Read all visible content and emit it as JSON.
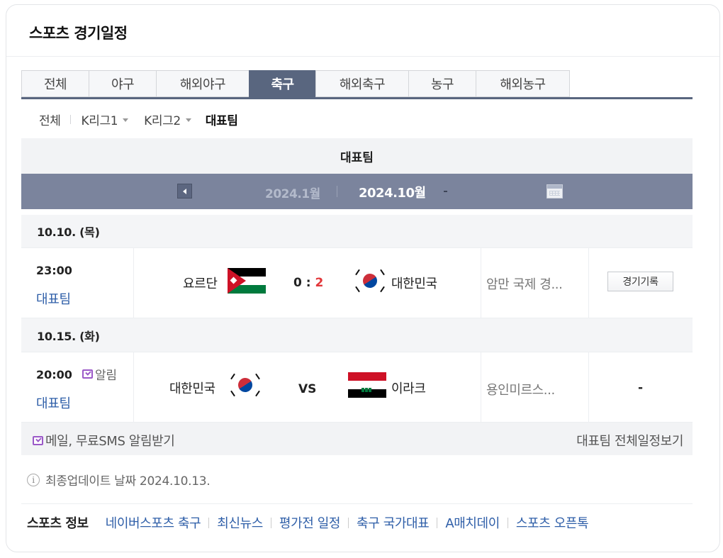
{
  "card": {
    "title": "스포츠 경기일정"
  },
  "tabs": [
    {
      "label": "전체",
      "active": false
    },
    {
      "label": "야구",
      "active": false
    },
    {
      "label": "해외야구",
      "active": false
    },
    {
      "label": "축구",
      "active": true
    },
    {
      "label": "해외축구",
      "active": false
    },
    {
      "label": "농구",
      "active": false
    },
    {
      "label": "해외농구",
      "active": false
    }
  ],
  "subtabs": [
    {
      "label": "전체"
    },
    {
      "label": "K리그1"
    },
    {
      "label": "K리그2"
    },
    {
      "label": "대표팀",
      "active": true
    }
  ],
  "section": {
    "title": "대표팀",
    "prev_month": "2024.1월",
    "current_month": "2024.10월",
    "calendar_icon": "calendar-icon"
  },
  "days": [
    {
      "date": "10.10. (목)",
      "game": {
        "time": "23:00",
        "category": "대표팀",
        "home": {
          "name": "요르단",
          "flag": "jordan-flag"
        },
        "score_home": "0",
        "score_sep": ":",
        "score_away": "2",
        "away": {
          "name": "대한민국",
          "flag": "south-korea-flag"
        },
        "venue": "암만 국제 경...",
        "record_label": "경기기록"
      }
    },
    {
      "date": "10.15. (화)",
      "game": {
        "time": "20:00",
        "alarm_label": "알림",
        "category": "대표팀",
        "home": {
          "name": "대한민국",
          "flag": "south-korea-flag"
        },
        "vs_label": "VS",
        "away": {
          "name": "이라크",
          "flag": "iraq-flag"
        },
        "venue": "용인미르스...",
        "record_label": "-"
      }
    }
  ],
  "footer": {
    "alarm_text": "메일, 무료SMS 알림받기",
    "all_schedule": "대표팀 전체일정보기"
  },
  "update": {
    "text": "최종업데이트 날짜 2024.10.13."
  },
  "sports_info": {
    "label": "스포츠 정보",
    "links": [
      "네이버스포츠 축구",
      "최신뉴스",
      "평가전 일정",
      "축구 국가대표",
      "A매치데이",
      "스포츠 오픈톡"
    ]
  },
  "colors": {
    "accent": "#59667f",
    "month_bar": "#7b849d",
    "link": "#2e5ea8",
    "win_score": "#e2373a",
    "alarm": "#9b59c8"
  }
}
